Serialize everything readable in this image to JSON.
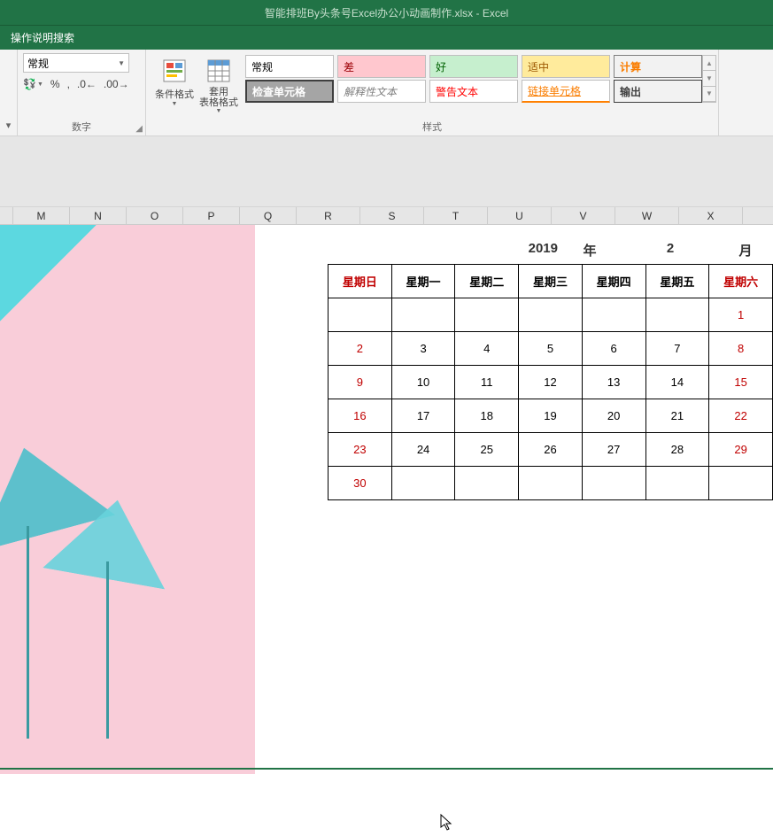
{
  "title": "智能排班By头条号Excel办公小动画制作.xlsx  -  Excel",
  "search_label": "操作说明搜索",
  "number": {
    "format_value": "常规",
    "group_label": "数字"
  },
  "cond_format": "条件格式",
  "table_format": "套用\n表格格式",
  "styles": {
    "normal": "常规",
    "bad": "差",
    "good": "好",
    "neutral": "适中",
    "calc": "计算",
    "check": "检查单元格",
    "explain": "解释性文本",
    "warn": "警告文本",
    "link": "链接单元格",
    "output": "输出",
    "group_label": "样式"
  },
  "columns": [
    "M",
    "N",
    "O",
    "P",
    "Q",
    "R",
    "S",
    "T",
    "U",
    "V",
    "W",
    "X"
  ],
  "year_row": {
    "y": "2019",
    "ylab": "年",
    "m": "2",
    "mlab": "月"
  },
  "weekdays": [
    "星期日",
    "星期一",
    "星期二",
    "星期三",
    "星期四",
    "星期五",
    "星期六"
  ],
  "cal": [
    [
      "",
      "",
      "",
      "",
      "",
      "",
      "1"
    ],
    [
      "2",
      "3",
      "4",
      "5",
      "6",
      "7",
      "8"
    ],
    [
      "9",
      "10",
      "11",
      "12",
      "13",
      "14",
      "15"
    ],
    [
      "16",
      "17",
      "18",
      "19",
      "20",
      "21",
      "22"
    ],
    [
      "23",
      "24",
      "25",
      "26",
      "27",
      "28",
      "29"
    ],
    [
      "30",
      "",
      "",
      "",
      "",
      "",
      ""
    ]
  ]
}
